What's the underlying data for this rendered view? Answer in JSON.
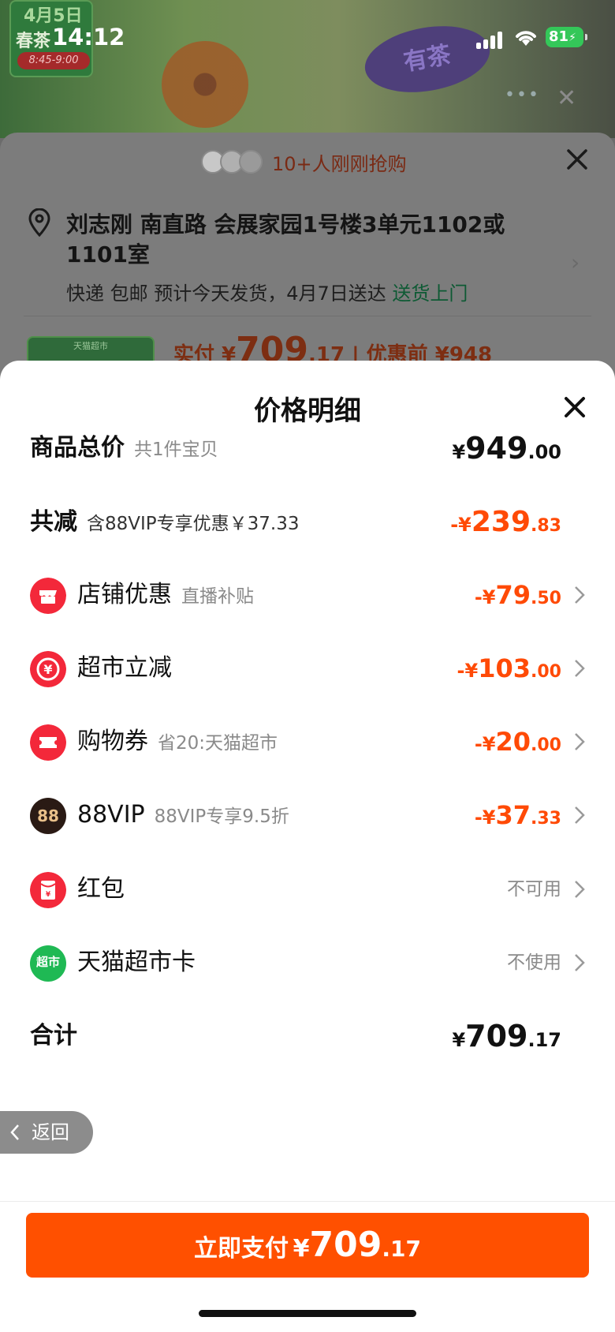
{
  "status_bar": {
    "time": "14:12",
    "battery": "81"
  },
  "background": {
    "badge_date": "4月5日",
    "badge_title": "春茶",
    "badge_time": "8:45-9:00",
    "oval_text": "有茶"
  },
  "order": {
    "buyers_text": "10+人刚刚抢购",
    "address": "刘志刚 南直路 会展家园1号楼3单元1102或1101室",
    "shipping": "快递 包邮 预计今天发货，4月7日送达",
    "shipping_link": "送货上门",
    "thumb_label": "天猫超市",
    "paid_prefix": "实付 ¥",
    "paid_int": "709",
    "paid_dec": ".17",
    "paid_suffix": " | 优惠前 ¥948"
  },
  "modal": {
    "title": "价格明细",
    "total_goods": {
      "label": "商品总价",
      "sub": "共1件宝贝",
      "cur": "¥",
      "int": "949",
      "dec": ".00"
    },
    "total_reduce": {
      "label": "共减",
      "sub": "含88VIP专享优惠￥37.33",
      "cur": "-¥",
      "int": "239",
      "dec": ".83"
    },
    "items": [
      {
        "label": "店铺优惠",
        "sub": "直播补贴",
        "cur": "-¥",
        "int": "79",
        "dec": ".50",
        "icon": "shop-icon"
      },
      {
        "label": "超市立减",
        "sub": "",
        "cur": "-¥",
        "int": "103",
        "dec": ".00",
        "icon": "supermarket-discount-icon"
      },
      {
        "label": "购物券",
        "sub": "省20:天猫超市",
        "cur": "-¥",
        "int": "20",
        "dec": ".00",
        "icon": "coupon-icon"
      },
      {
        "label": "88VIP",
        "sub": "88VIP专享9.5折",
        "cur": "-¥",
        "int": "37",
        "dec": ".33",
        "icon": "vip88-icon",
        "icon_text": "88"
      },
      {
        "label": "红包",
        "status": "不可用",
        "icon": "red-packet-icon"
      },
      {
        "label": "天猫超市卡",
        "status": "不使用",
        "icon": "tmall-card-icon",
        "icon_text": "超市"
      }
    ],
    "total": {
      "label": "合计",
      "cur": "¥",
      "int": "709",
      "dec": ".17"
    },
    "back_label": "返回",
    "pay": {
      "label": "立即支付",
      "cur": "¥",
      "int": "709",
      "dec": ".17"
    }
  },
  "colors": {
    "accent": "#ff5000",
    "discount": "#ff4a06",
    "icon_red": "#f3283a"
  }
}
